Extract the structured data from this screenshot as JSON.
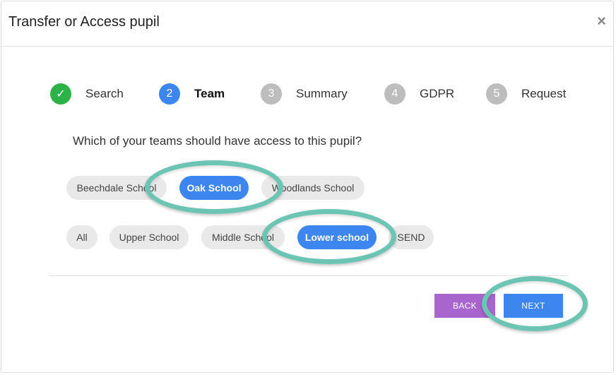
{
  "dialog": {
    "title": "Transfer or Access pupil",
    "close_symbol": "×"
  },
  "steps": [
    {
      "indicator": "✓",
      "label": "Search",
      "state": "done"
    },
    {
      "indicator": "2",
      "label": "Team",
      "state": "active"
    },
    {
      "indicator": "3",
      "label": "Summary",
      "state": "pending"
    },
    {
      "indicator": "4",
      "label": "GDPR",
      "state": "pending"
    },
    {
      "indicator": "5",
      "label": "Request",
      "state": "pending"
    }
  ],
  "question": "Which of your teams should have access to this pupil?",
  "schools": [
    {
      "label": "Beechdale School",
      "selected": false
    },
    {
      "label": "Oak School",
      "selected": true
    },
    {
      "label": "Woodlands School",
      "selected": false
    }
  ],
  "teams": [
    {
      "label": "All",
      "selected": false
    },
    {
      "label": "Upper School",
      "selected": false
    },
    {
      "label": "Middle School",
      "selected": false
    },
    {
      "label": "Lower school",
      "selected": true
    },
    {
      "label": "SEND",
      "selected": false
    }
  ],
  "buttons": {
    "back": "BACK",
    "next": "NEXT"
  },
  "colors": {
    "accent_blue": "#3d86f0",
    "done_green": "#2db24a",
    "back_purple": "#a865cd",
    "highlight_ring": "#6cc4b3"
  }
}
